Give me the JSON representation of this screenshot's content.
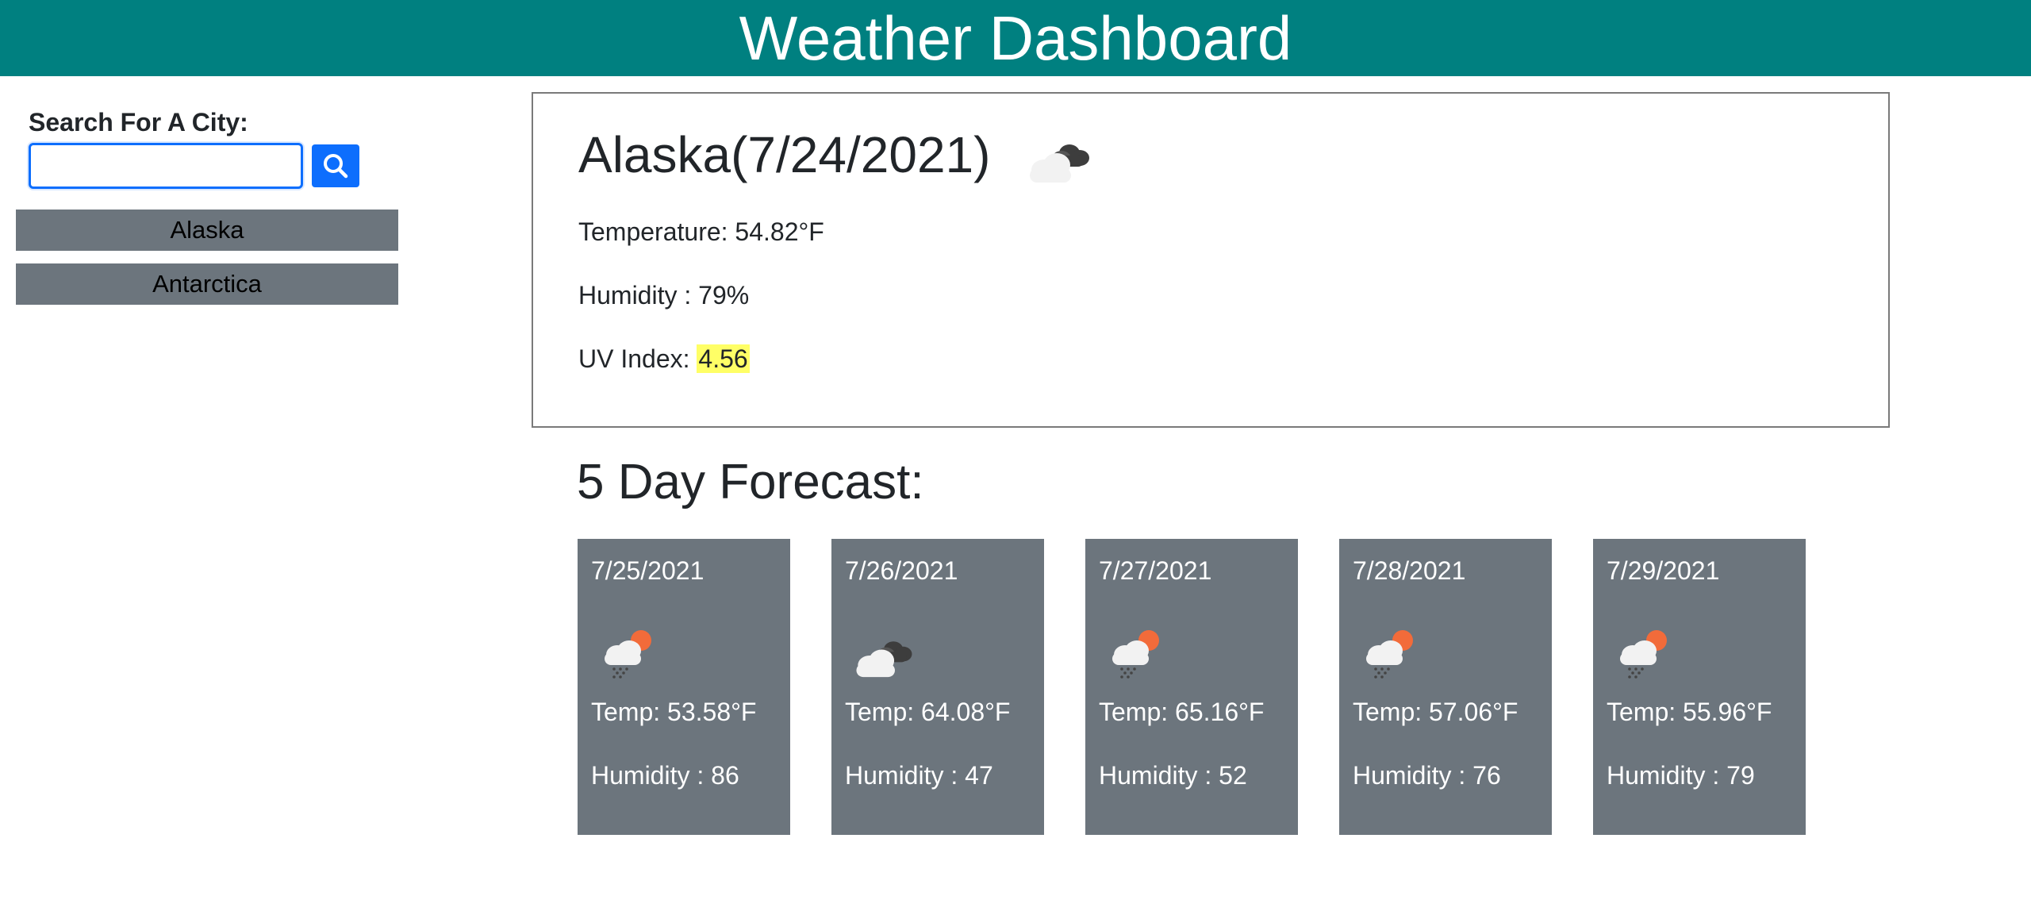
{
  "header": {
    "title": "Weather Dashboard"
  },
  "sidebar": {
    "search_label": "Search For A City:",
    "search_value": "",
    "history": [
      {
        "label": "Alaska"
      },
      {
        "label": "Antarctica"
      }
    ]
  },
  "current": {
    "title": "Alaska(7/24/2021)",
    "icon": "clouds-icon",
    "temperature_label": "Temperature: 54.82°F",
    "humidity_label": "Humidity : 79%",
    "uv_label": "UV Index:",
    "uv_value": "4.56"
  },
  "forecast": {
    "heading": "5 Day Forecast:",
    "days": [
      {
        "date": "7/25/2021",
        "icon": "rain-sun-icon",
        "temp": "Temp: 53.58°F",
        "humidity": "Humidity : 86"
      },
      {
        "date": "7/26/2021",
        "icon": "clouds-icon",
        "temp": "Temp: 64.08°F",
        "humidity": "Humidity : 47"
      },
      {
        "date": "7/27/2021",
        "icon": "rain-sun-icon",
        "temp": "Temp: 65.16°F",
        "humidity": "Humidity : 52"
      },
      {
        "date": "7/28/2021",
        "icon": "rain-sun-icon",
        "temp": "Temp: 57.06°F",
        "humidity": "Humidity : 76"
      },
      {
        "date": "7/29/2021",
        "icon": "rain-sun-icon",
        "temp": "Temp: 55.96°F",
        "humidity": "Humidity : 79"
      }
    ]
  },
  "colors": {
    "header_bg": "#008080",
    "accent": "#0d6efd",
    "card_bg": "#6c757d",
    "uv_highlight": "#ffff66"
  }
}
